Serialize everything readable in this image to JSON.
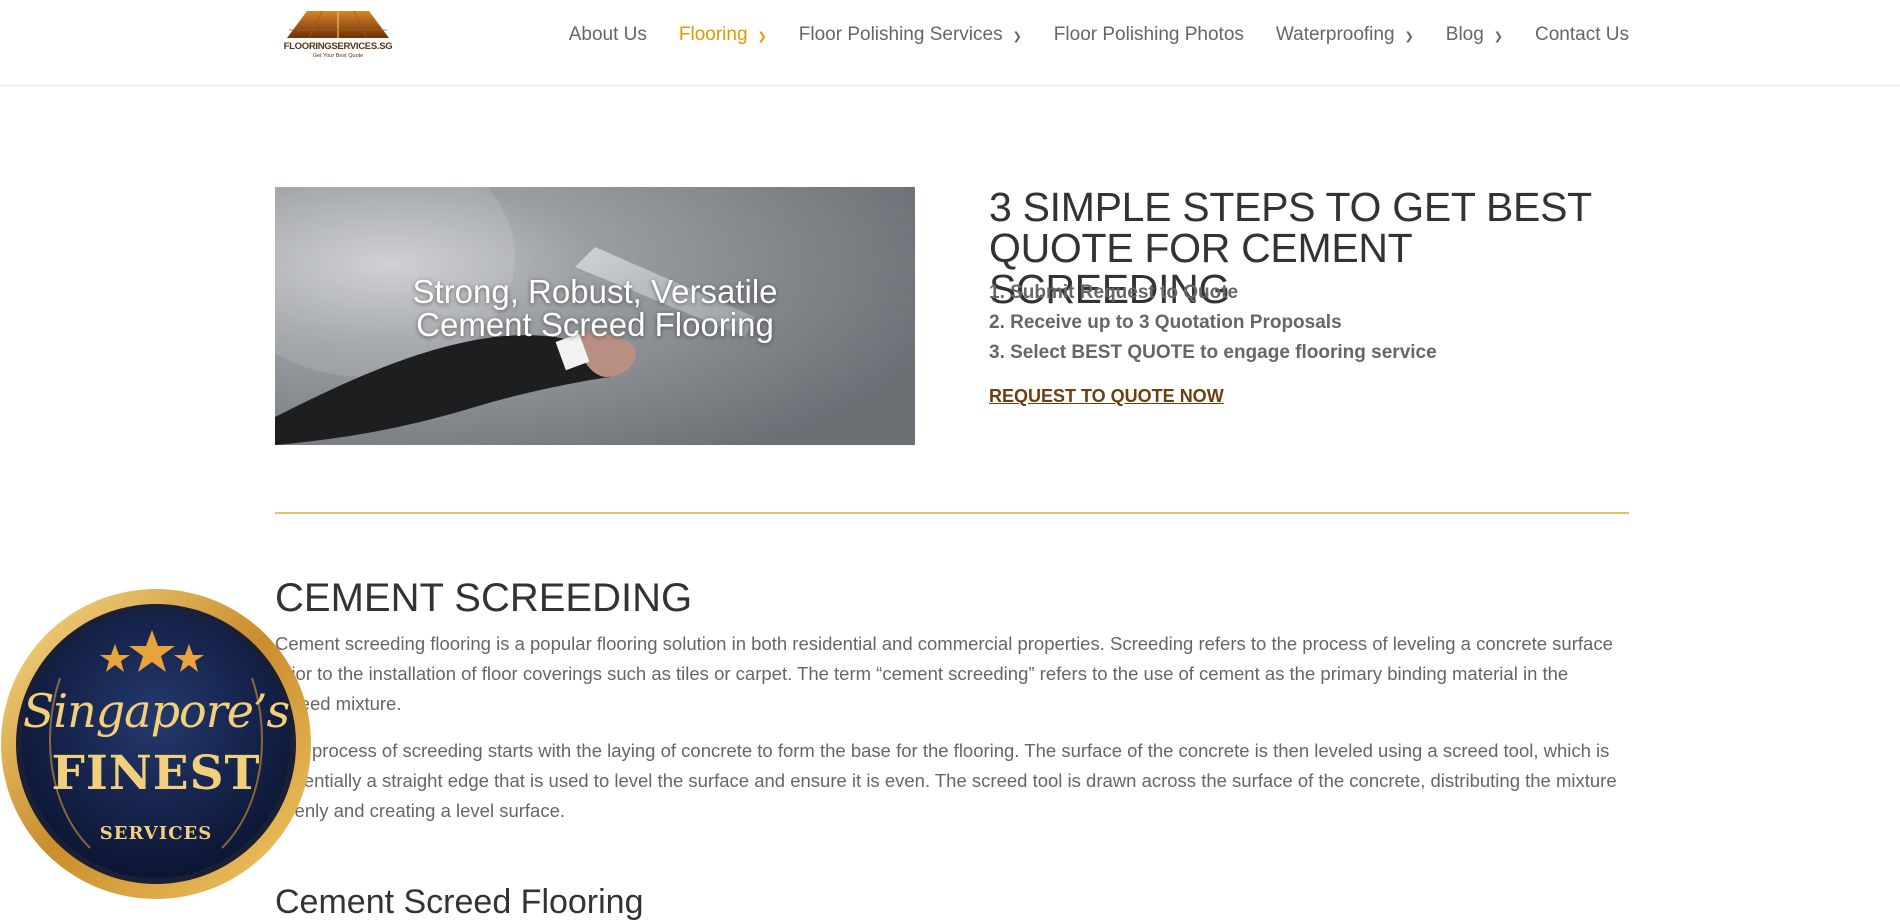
{
  "brand": {
    "name": "FLOORINGSERVICES.SG",
    "tagline": "Get Your Best Quote"
  },
  "nav": {
    "items": [
      {
        "label": "About Us",
        "dropdown": false,
        "active": false
      },
      {
        "label": "Flooring",
        "dropdown": true,
        "active": true
      },
      {
        "label": "Floor Polishing Services",
        "dropdown": true,
        "active": false
      },
      {
        "label": "Floor Polishing Photos",
        "dropdown": false,
        "active": false
      },
      {
        "label": "Waterproofing",
        "dropdown": true,
        "active": false
      },
      {
        "label": "Blog",
        "dropdown": true,
        "active": false
      },
      {
        "label": "Contact Us",
        "dropdown": false,
        "active": false
      }
    ],
    "active_color": "#e09900"
  },
  "hero": {
    "line1": "Strong, Robust, Versatile",
    "line2": "Cement Screed Flooring"
  },
  "steps": {
    "title_line1": "3 SIMPLE STEPS TO GET BEST",
    "title_line2": "QUOTE FOR CEMENT SCREEDING",
    "items": [
      "1. Submit Request to Quote",
      "2. Receive up to 3 Quotation Proposals",
      "3. Select BEST QUOTE to engage flooring service"
    ],
    "cta": "REQUEST TO QUOTE NOW"
  },
  "section": {
    "title": "CEMENT SCREEDING",
    "paragraphs": [
      "Cement screeding flooring is a popular flooring solution in both residential and commercial properties. Screeding refers to the process of leveling a concrete surface prior to the installation of floor coverings such as tiles or carpet. The term “cement screeding” refers to the use of cement as the primary binding material in the screed mixture.",
      "The process of screeding starts with the laying of concrete to form the base for the flooring. The surface of the concrete is then leveled using a screed tool, which is essentially a straight edge that is used to level the surface and ensure it is even. The screed tool is drawn across the surface of the concrete, distributing the mixture evenly and creating a level surface."
    ],
    "next_heading": "Cement Screed Flooring"
  },
  "badge": {
    "script": "Singapore’s",
    "main": "FINEST",
    "sub": "SERVICES"
  },
  "colors": {
    "accent_gold": "#e6c36b",
    "link_brown": "#6b3f10",
    "badge_navy": "#121f45"
  }
}
